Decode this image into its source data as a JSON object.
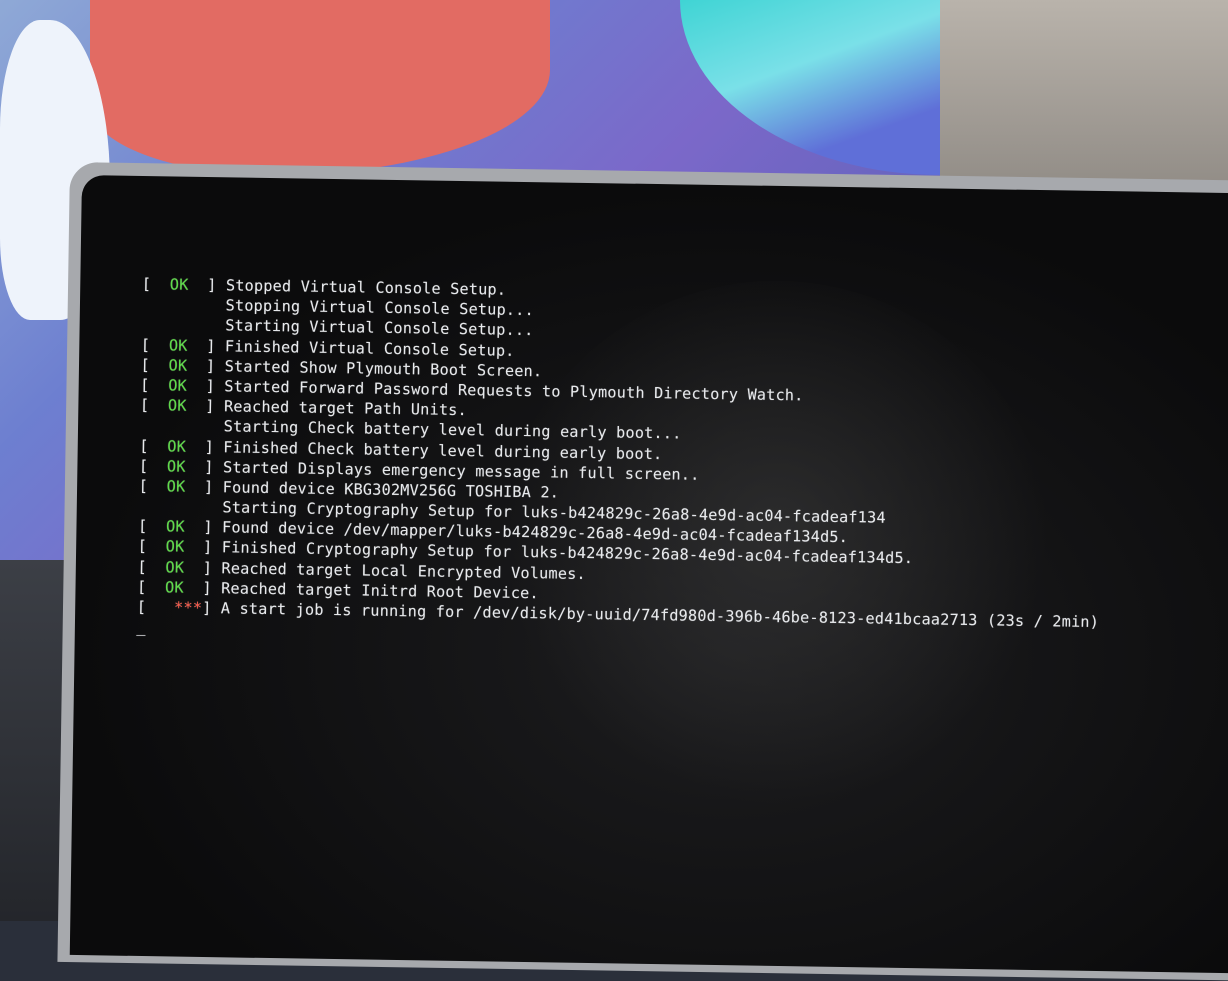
{
  "console": {
    "status_ok": "OK",
    "status_running": "***",
    "lines": [
      {
        "status": "ok",
        "text": "Stopped Virtual Console Setup."
      },
      {
        "status": "none",
        "text": "Stopping Virtual Console Setup..."
      },
      {
        "status": "none",
        "text": "Starting Virtual Console Setup..."
      },
      {
        "status": "ok",
        "text": "Finished Virtual Console Setup."
      },
      {
        "status": "ok",
        "text": "Started Show Plymouth Boot Screen."
      },
      {
        "status": "ok",
        "text": "Started Forward Password Requests to Plymouth Directory Watch."
      },
      {
        "status": "ok",
        "text": "Reached target Path Units."
      },
      {
        "status": "none",
        "text": "Starting Check battery level during early boot..."
      },
      {
        "status": "ok",
        "text": "Finished Check battery level during early boot."
      },
      {
        "status": "ok",
        "text": "Started Displays emergency message in full screen.."
      },
      {
        "status": "ok",
        "text": "Found device KBG302MV256G TOSHIBA 2."
      },
      {
        "status": "none",
        "text": "Starting Cryptography Setup for luks-b424829c-26a8-4e9d-ac04-fcadeaf134"
      },
      {
        "status": "ok",
        "text": "Found device /dev/mapper/luks-b424829c-26a8-4e9d-ac04-fcadeaf134d5."
      },
      {
        "status": "ok",
        "text": "Finished Cryptography Setup for luks-b424829c-26a8-4e9d-ac04-fcadeaf134d5."
      },
      {
        "status": "ok",
        "text": "Reached target Local Encrypted Volumes."
      },
      {
        "status": "ok",
        "text": "Reached target Initrd Root Device."
      },
      {
        "status": "running",
        "text": "A start job is running for /dev/disk/by-uuid/74fd980d-396b-46be-8123-ed41bcaa2713 (23s / 2min)"
      }
    ],
    "cursor": "_"
  },
  "colors": {
    "ok": "#5fdc4a",
    "running": "#ff5a4a",
    "text": "#e7e9ec",
    "screen": "#0b0b0c"
  }
}
